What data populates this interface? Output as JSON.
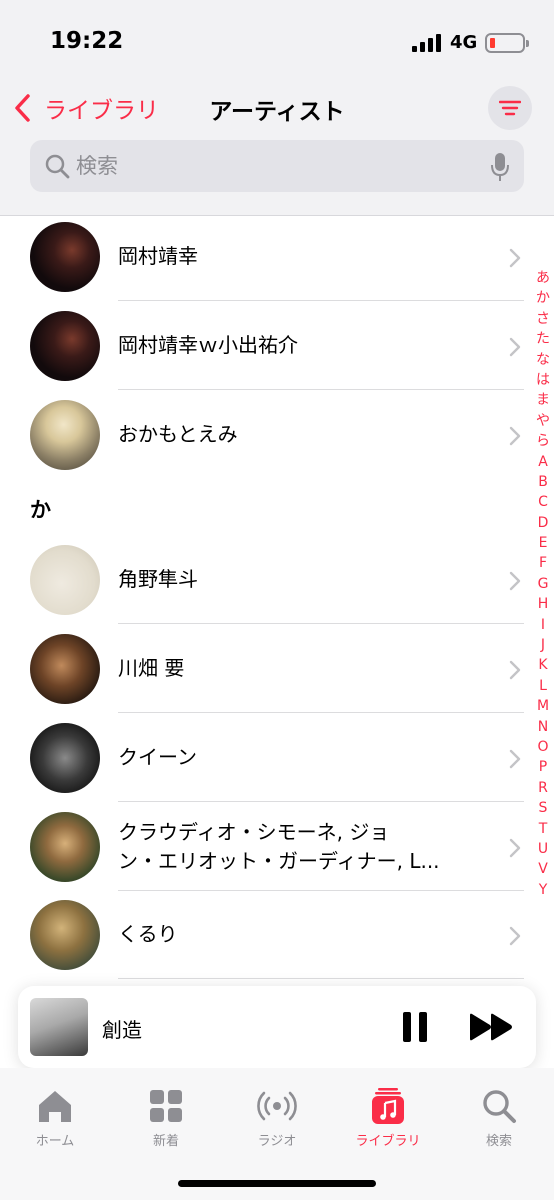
{
  "status": {
    "time": "19:22",
    "network": "4G"
  },
  "nav": {
    "back_label": "ライブラリ",
    "title": "アーティスト"
  },
  "search": {
    "placeholder": "検索"
  },
  "artists_o": [
    {
      "name": "岡村靖幸"
    },
    {
      "name": "岡村靖幸ｗ小出祐介"
    },
    {
      "name": "おかもとえみ"
    }
  ],
  "section_ka": {
    "label": "か"
  },
  "artists_ka": [
    {
      "name": "角野隼斗"
    },
    {
      "name": "川畑 要"
    },
    {
      "name": "クイーン"
    },
    {
      "name_line1": "クラウディオ・シモーネ, ジョ",
      "name_line2": "ン・エリオット・ガーディナー, L..."
    },
    {
      "name": "くるり"
    }
  ],
  "index_letters": [
    "あ",
    "か",
    "さ",
    "た",
    "な",
    "は",
    "ま",
    "や",
    "ら",
    "A",
    "B",
    "C",
    "D",
    "E",
    "F",
    "G",
    "H",
    "I",
    "J",
    "K",
    "L",
    "M",
    "N",
    "O",
    "P",
    "R",
    "S",
    "T",
    "U",
    "V",
    "Y"
  ],
  "now_playing": {
    "title": "創造"
  },
  "tabs": [
    {
      "label": "ホーム",
      "icon": "house-icon"
    },
    {
      "label": "新着",
      "icon": "grid-icon"
    },
    {
      "label": "ラジオ",
      "icon": "radio-waves-icon"
    },
    {
      "label": "ライブラリ",
      "icon": "music-library-icon"
    },
    {
      "label": "検索",
      "icon": "search-icon"
    }
  ],
  "colors": {
    "accent": "#fa2d48",
    "secondary_text": "#8e8e93",
    "nav_background": "#f2f2f4"
  }
}
